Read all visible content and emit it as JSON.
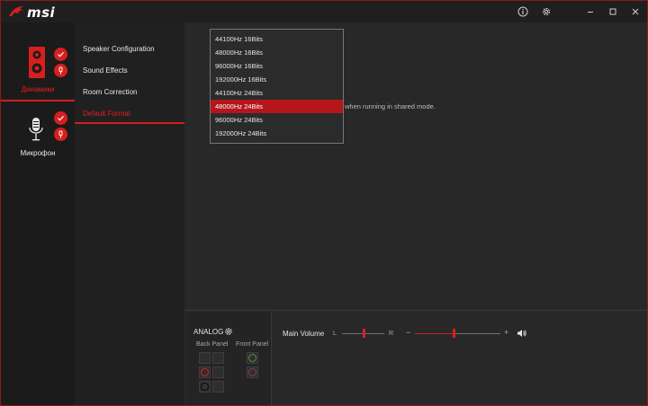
{
  "app": {
    "brand": "msi",
    "accent": "#d71f1f",
    "icons": [
      "dragon-logo-icon",
      "info-icon",
      "gear-icon",
      "minimize-icon",
      "maximize-icon",
      "close-icon"
    ]
  },
  "devices": [
    {
      "label": "Динамики",
      "icon": "speaker-icon",
      "active": true
    },
    {
      "label": "Микрофон",
      "icon": "microphone-icon",
      "active": false
    }
  ],
  "menu": [
    {
      "label": "Speaker Configuration",
      "active": false
    },
    {
      "label": "Sound Effects",
      "active": false
    },
    {
      "label": "Room Correction",
      "active": false
    },
    {
      "label": "Default Format",
      "active": true
    }
  ],
  "format_dropdown": {
    "selected": "48000Hz 24Bits",
    "options": [
      "44100Hz 16Bits",
      "48000Hz 16Bits",
      "96000Hz 16Bits",
      "192000Hz 16Bits",
      "44100Hz 24Bits",
      "48000Hz 24Bits",
      "96000Hz 24Bits",
      "192000Hz 24Bits"
    ]
  },
  "shared_mode_note": "when running in shared mode.",
  "analog": {
    "title": "ANALOG",
    "back_panel": "Back Panel",
    "front_panel": "Front Panel"
  },
  "volume": {
    "title": "Main Volume",
    "left": "L",
    "right": "R",
    "minus": "−",
    "plus": "+",
    "balance_fraction": 0.5,
    "volume_fraction": 0.45
  }
}
